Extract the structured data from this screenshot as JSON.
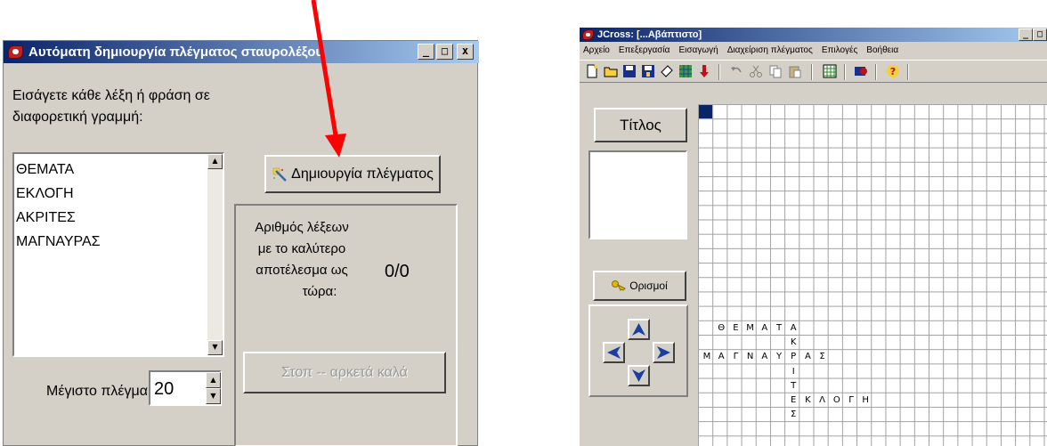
{
  "dialog": {
    "title": "Αυτόματη δημιουργία πλέγματος σταυρολέξου",
    "prompt_line1": "Εισάγετε κάθε λέξη ή φράση σε",
    "prompt_line2": "διαφορετική γραμμή:",
    "words": [
      "ΘΕΜΑΤΑ",
      "ΕΚΛΟΓΗ",
      "ΑΚΡΙΤΕΣ",
      "ΜΑΓΝΑΥΡΑΣ"
    ],
    "generate_button": "Δημιουργία πλέγματος",
    "count_label_lines": [
      "Αριθμός λέξεων",
      "με το καλύτερο",
      "αποτέλεσμα ως",
      "τώρα:"
    ],
    "count_value": "0/0",
    "stop_button": "Στοπ -- αρκετά καλά",
    "max_grid_label": "Μέγιστο πλέγμα:",
    "max_grid_value": "20",
    "window_buttons": [
      "_",
      "□",
      "x"
    ]
  },
  "jcross": {
    "title": "JCross: [...Αβάπτιστο]",
    "menu": [
      "Αρχείο",
      "Επεξεργασία",
      "Εισαγωγή",
      "Διαχείριση πλέγματος",
      "Επιλογές",
      "Βοήθεια"
    ],
    "title_button": "Τίτλος",
    "definitions_button": "Ορισμοί",
    "window_buttons": [
      "_",
      "□"
    ],
    "grid_rows": [
      {
        "row": 15,
        "col": 1,
        "letters": [
          "Θ",
          "Ε",
          "Μ",
          "Α",
          "Τ",
          "Α"
        ]
      },
      {
        "row": 16,
        "col": 6,
        "letters": [
          "Κ"
        ]
      },
      {
        "row": 17,
        "col": 0,
        "letters": [
          "Μ",
          "Α",
          "Γ",
          "Ν",
          "Α",
          "Υ",
          "Ρ",
          "Α",
          "Σ"
        ]
      },
      {
        "row": 18,
        "col": 6,
        "letters": [
          "Ι"
        ]
      },
      {
        "row": 19,
        "col": 6,
        "letters": [
          "Τ"
        ]
      },
      {
        "row": 20,
        "col": 6,
        "letters": [
          "Ε",
          "Κ",
          "Λ",
          "Ο",
          "Γ",
          "Η"
        ]
      },
      {
        "row": 21,
        "col": 6,
        "letters": [
          "Σ"
        ]
      }
    ]
  },
  "colors": {
    "titlebar": "#0a246a",
    "face": "#d4d0c8",
    "arrow": "#ff0000",
    "nav_arrow": "#1a3fa0"
  }
}
